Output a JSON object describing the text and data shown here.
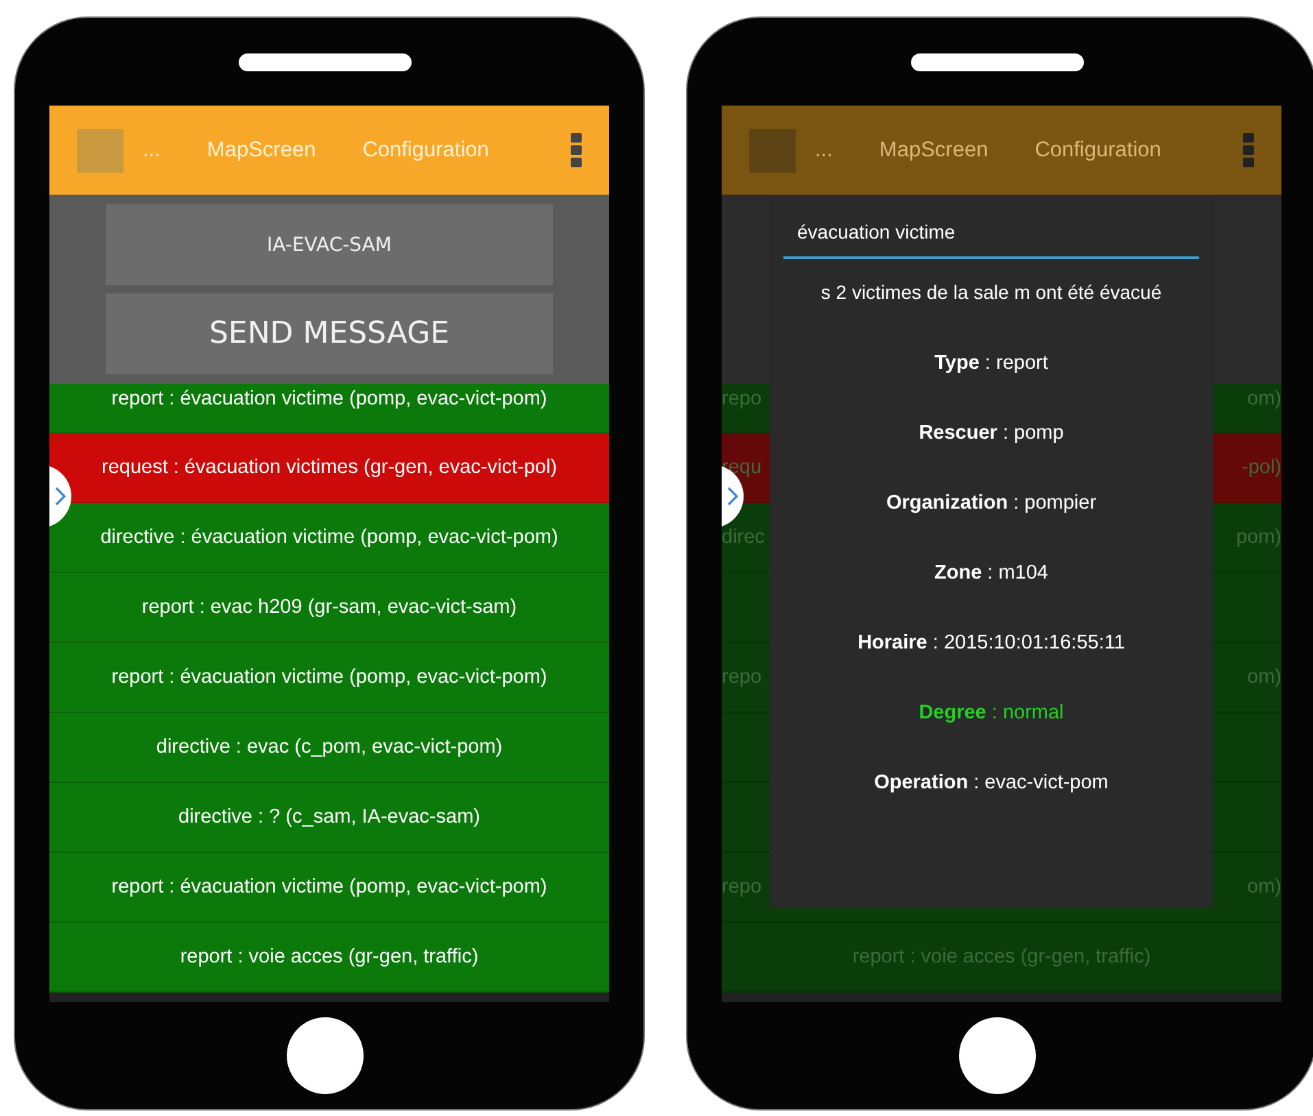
{
  "phones": [
    {
      "dimmed": false,
      "header": {
        "ellipsis": "...",
        "tabs": [
          "MapScreen",
          "Configuration"
        ]
      },
      "recipient": "IA-EVAC-SAM",
      "send_button": "SEND MESSAGE",
      "messages": [
        {
          "text": "report : évacuation victime  (pomp, evac-vict-pom)",
          "color": "#0b7a0b"
        },
        {
          "text": "request : évacuation victimes  (gr-gen, evac-vict-pol)",
          "color": "#cc0a0a"
        },
        {
          "text": "directive : évacuation victime (pomp, evac-vict-pom)",
          "color": "#0b7a0b"
        },
        {
          "text": "report : evac h209 (gr-sam, evac-vict-sam)",
          "color": "#0b7a0b"
        },
        {
          "text": "report : évacuation victime  (pomp, evac-vict-pom)",
          "color": "#0b7a0b"
        },
        {
          "text": "directive : evac (c_pom, evac-vict-pom)",
          "color": "#0b7a0b"
        },
        {
          "text": "directive : ? (c_sam, IA-evac-sam)",
          "color": "#0b7a0b"
        },
        {
          "text": "report : évacuation victime  (pomp, evac-vict-pom)",
          "color": "#0b7a0b"
        },
        {
          "text": "report : voie  acces (gr-gen, traffic)",
          "color": "#0b7a0b"
        }
      ]
    },
    {
      "dimmed": true,
      "header": {
        "ellipsis": "...",
        "tabs": [
          "MapScreen",
          "Configuration"
        ]
      },
      "messages": [
        {
          "left": "repo",
          "right": "om)",
          "color": "#0a3d0a"
        },
        {
          "left": "requ",
          "right": "-pol)",
          "color": "#640808"
        },
        {
          "left": "direc",
          "right": "pom)",
          "color": "#0a3d0a"
        },
        {
          "color": "#0a3d0a"
        },
        {
          "left": "repo",
          "right": "om)",
          "color": "#0a3d0a"
        },
        {
          "color": "#0a3d0a"
        },
        {
          "color": "#0a3d0a"
        },
        {
          "left": "repo",
          "right": "om)",
          "color": "#0a3d0a"
        },
        {
          "text": "report : voie  acces (gr-gen, traffic)",
          "color": "#0a3d0a"
        }
      ],
      "dialog": {
        "title": "évacuation victime",
        "body": "s 2 victimes de la sale m ont été évacué",
        "fields": [
          {
            "text": "**Type** : report",
            "color": "#ffffff"
          },
          {
            "text": "**Rescuer** : pomp",
            "color": "#ffffff"
          },
          {
            "text": "**Organization** : pompier",
            "color": "#ffffff"
          },
          {
            "text": "**Zone** : m104",
            "color": "#ffffff"
          },
          {
            "text": "**Horaire** : 2015:10:01:16:55:11",
            "color": "#ffffff"
          },
          {
            "text": "**Degree** : normal",
            "color": "#22d022"
          },
          {
            "text": "**Operation** : evac-vict-pom",
            "color": "#ffffff"
          }
        ]
      }
    }
  ]
}
